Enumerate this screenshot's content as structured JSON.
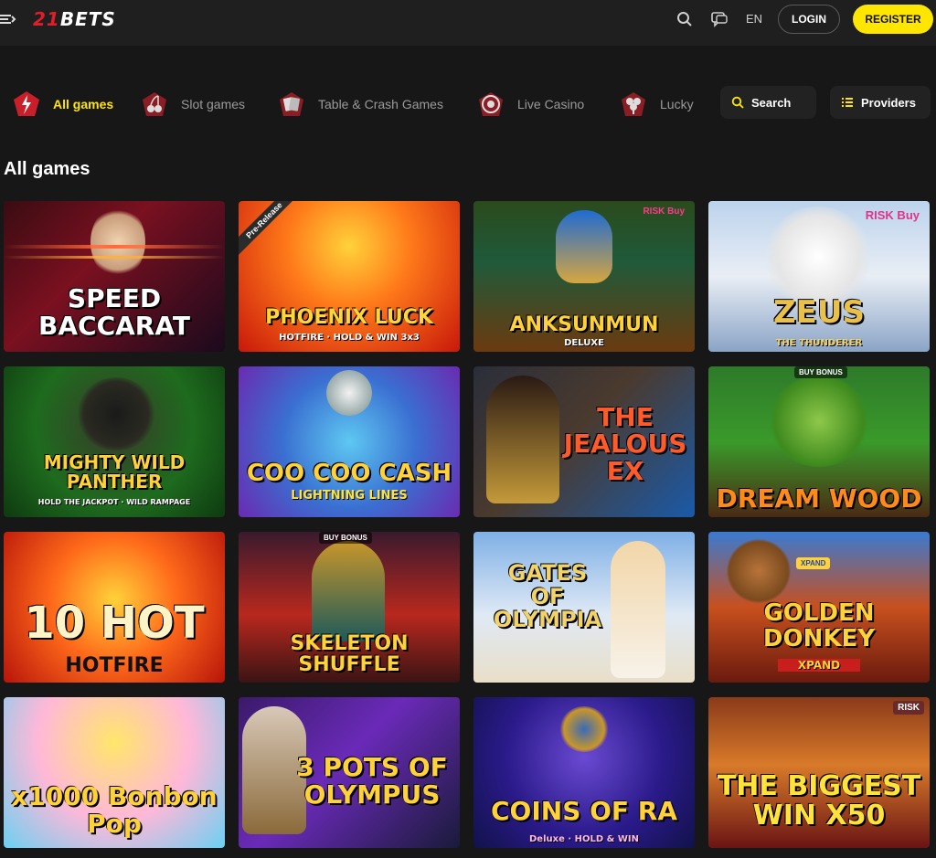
{
  "header": {
    "logo_num": "21",
    "logo_word": "BETS",
    "lang": "EN",
    "login_label": "LOGIN",
    "register_label": "REGISTER"
  },
  "categories": [
    {
      "label": "All games",
      "active": true
    },
    {
      "label": "Slot games",
      "active": false
    },
    {
      "label": "Table & Crash Games",
      "active": false
    },
    {
      "label": "Live Casino",
      "active": false
    },
    {
      "label": "Lucky",
      "active": false
    }
  ],
  "search_label": "Search",
  "providers_label": "Providers",
  "section_title": "All games",
  "colors": {
    "accent": "#ffe600",
    "brand_red": "#e11d2a",
    "bg": "#171717"
  },
  "games": [
    {
      "title": "SPEED BACCARAT",
      "sub": "",
      "badge": ""
    },
    {
      "title": "PHOENIX LUCK",
      "sub": "HOTFIRE · HOLD & WIN 3x3",
      "badge": "Pre-Release"
    },
    {
      "title": "ANKSUNMUN",
      "sub": "DELUXE",
      "badge": "RISK Buy"
    },
    {
      "title": "ZEUS",
      "sub": "THE THUNDERER",
      "badge": "RISK Buy"
    },
    {
      "title": "MIGHTY WILD PANTHER",
      "sub": "HOLD THE JACKPOT · WILD RAMPAGE",
      "badge": ""
    },
    {
      "title": "COO COO CASH",
      "sub": "LIGHTNING LINES",
      "badge": ""
    },
    {
      "title": "THE JEALOUS EX",
      "sub": "",
      "badge": ""
    },
    {
      "title": "DREAM WOOD",
      "sub": "",
      "badge": "BUY BONUS"
    },
    {
      "title": "10 HOT",
      "sub": "HOTFIRE",
      "badge": ""
    },
    {
      "title": "SKELETON SHUFFLE",
      "sub": "",
      "badge": "BUY BONUS"
    },
    {
      "title": "GATES OF OLYMPIA",
      "sub": "",
      "badge": ""
    },
    {
      "title": "GOLDEN DONKEY",
      "sub": "XPAND",
      "badge": "XPAND"
    },
    {
      "title": "x1000 Bonbon Pop",
      "sub": "",
      "badge": ""
    },
    {
      "title": "3 POTS OF OLYMPUS",
      "sub": "",
      "badge": ""
    },
    {
      "title": "COINS OF RA",
      "sub": "Deluxe · HOLD & WIN",
      "badge": ""
    },
    {
      "title": "THE BIGGEST WIN X50",
      "sub": "",
      "badge": "RISK"
    }
  ]
}
